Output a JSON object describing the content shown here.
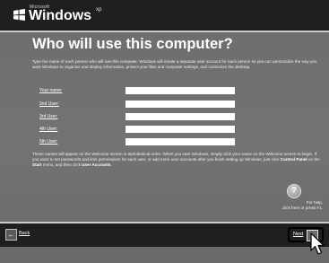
{
  "logo": {
    "ms_text": "Microsoft",
    "brand": "Windows",
    "edition": "xp"
  },
  "page": {
    "heading": "Who will use this computer?",
    "intro": "Type the name of each person who will use this computer. Windows will create a separate user account for each person so you can personalize the way you want Windows to organize and display information, protect your files and computer settings, and customize the desktop."
  },
  "users": [
    {
      "label": "Your name:",
      "value": "",
      "placeholder": ""
    },
    {
      "label": "2nd User:",
      "value": "",
      "placeholder": ""
    },
    {
      "label": "3rd User:",
      "value": "",
      "placeholder": ""
    },
    {
      "label": "4th User:",
      "value": "",
      "placeholder": ""
    },
    {
      "label": "5th User:",
      "value": "",
      "placeholder": ""
    }
  ],
  "note": {
    "text_a": "These names will appear on the Welcome screen in alphabetical order. When you start Windows, simply click your name on the Welcome screen to begin. If you want to set passwords and limit permissions for each user, or add more user accounts after you finish setting up Windows, just click ",
    "bold_a": "Control Panel",
    "text_b": " on the ",
    "bold_b": "Start",
    "text_c": " menu, and then click ",
    "bold_c": "User Accounts",
    "text_d": "."
  },
  "help": {
    "icon": "?",
    "line1": "For help,",
    "line2": "click here or press F1."
  },
  "nav": {
    "back_label": "Back",
    "next_label": "Next",
    "back_arrow": "←",
    "next_arrow": "→"
  },
  "colors": {
    "background": "#707070",
    "bars": "#1f1f1f",
    "text": "#ffffff"
  }
}
